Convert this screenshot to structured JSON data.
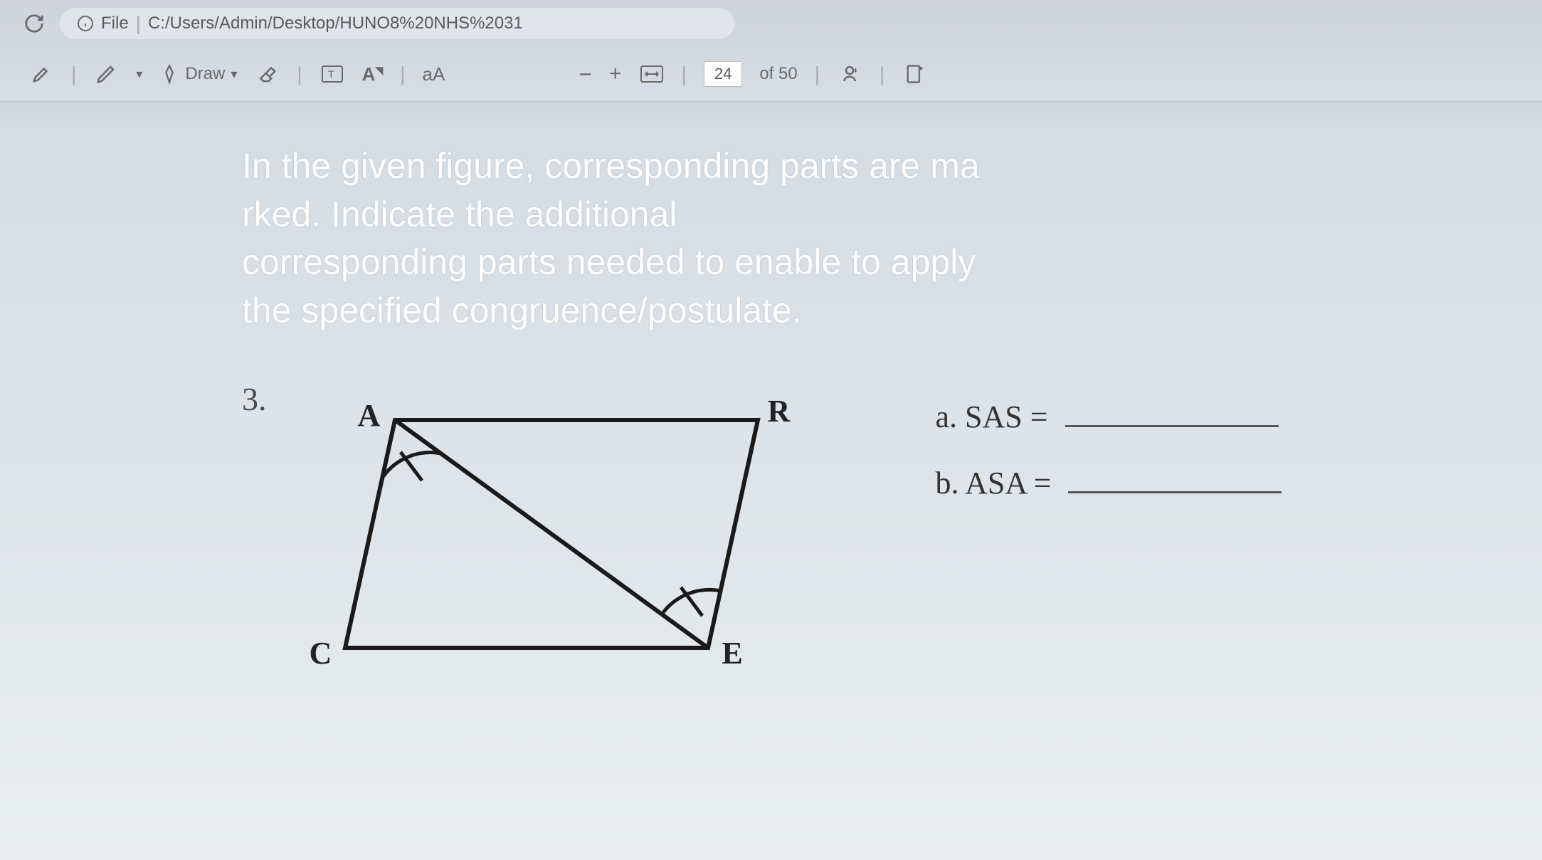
{
  "browser": {
    "file_label": "File",
    "path": "C:/Users/Admin/Desktop/HUNO8%20NHS%2031"
  },
  "toolbar": {
    "draw": "Draw",
    "text_a": "A",
    "text_ab": "aA",
    "zoom_minus": "−",
    "zoom_plus": "+",
    "page_current": "24",
    "page_total": "of 50"
  },
  "overlay": {
    "line1": "In the given figure, corresponding parts are ma",
    "line2": "rked. Indicate the additional",
    "line3": "corresponding parts needed to enable to apply",
    "line4": " the specified congruence/postulate."
  },
  "question": {
    "number": "3.",
    "labels": {
      "A": "A",
      "R": "R",
      "C": "C",
      "E": "E"
    },
    "answers": {
      "a_label": "a. SAS =",
      "b_label": "b. ASA ="
    }
  }
}
